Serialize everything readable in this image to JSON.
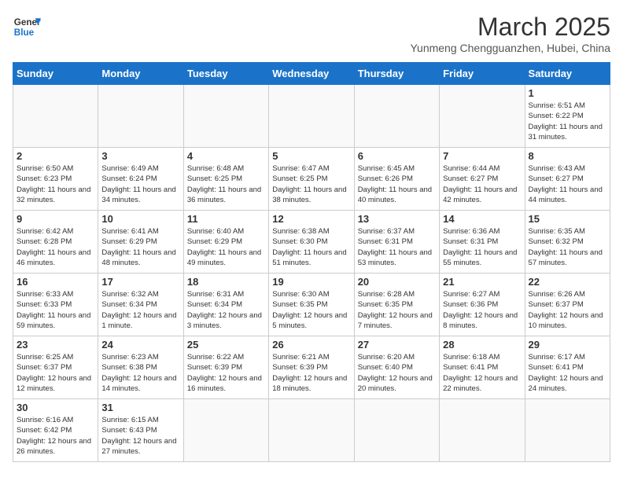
{
  "header": {
    "logo_general": "General",
    "logo_blue": "Blue",
    "title": "March 2025",
    "location": "Yunmeng Chengguanzhen, Hubei, China"
  },
  "weekdays": [
    "Sunday",
    "Monday",
    "Tuesday",
    "Wednesday",
    "Thursday",
    "Friday",
    "Saturday"
  ],
  "weeks": [
    [
      {
        "day": "",
        "info": ""
      },
      {
        "day": "",
        "info": ""
      },
      {
        "day": "",
        "info": ""
      },
      {
        "day": "",
        "info": ""
      },
      {
        "day": "",
        "info": ""
      },
      {
        "day": "",
        "info": ""
      },
      {
        "day": "1",
        "info": "Sunrise: 6:51 AM\nSunset: 6:22 PM\nDaylight: 11 hours and 31 minutes."
      }
    ],
    [
      {
        "day": "2",
        "info": "Sunrise: 6:50 AM\nSunset: 6:23 PM\nDaylight: 11 hours and 32 minutes."
      },
      {
        "day": "3",
        "info": "Sunrise: 6:49 AM\nSunset: 6:24 PM\nDaylight: 11 hours and 34 minutes."
      },
      {
        "day": "4",
        "info": "Sunrise: 6:48 AM\nSunset: 6:25 PM\nDaylight: 11 hours and 36 minutes."
      },
      {
        "day": "5",
        "info": "Sunrise: 6:47 AM\nSunset: 6:25 PM\nDaylight: 11 hours and 38 minutes."
      },
      {
        "day": "6",
        "info": "Sunrise: 6:45 AM\nSunset: 6:26 PM\nDaylight: 11 hours and 40 minutes."
      },
      {
        "day": "7",
        "info": "Sunrise: 6:44 AM\nSunset: 6:27 PM\nDaylight: 11 hours and 42 minutes."
      },
      {
        "day": "8",
        "info": "Sunrise: 6:43 AM\nSunset: 6:27 PM\nDaylight: 11 hours and 44 minutes."
      }
    ],
    [
      {
        "day": "9",
        "info": "Sunrise: 6:42 AM\nSunset: 6:28 PM\nDaylight: 11 hours and 46 minutes."
      },
      {
        "day": "10",
        "info": "Sunrise: 6:41 AM\nSunset: 6:29 PM\nDaylight: 11 hours and 48 minutes."
      },
      {
        "day": "11",
        "info": "Sunrise: 6:40 AM\nSunset: 6:29 PM\nDaylight: 11 hours and 49 minutes."
      },
      {
        "day": "12",
        "info": "Sunrise: 6:38 AM\nSunset: 6:30 PM\nDaylight: 11 hours and 51 minutes."
      },
      {
        "day": "13",
        "info": "Sunrise: 6:37 AM\nSunset: 6:31 PM\nDaylight: 11 hours and 53 minutes."
      },
      {
        "day": "14",
        "info": "Sunrise: 6:36 AM\nSunset: 6:31 PM\nDaylight: 11 hours and 55 minutes."
      },
      {
        "day": "15",
        "info": "Sunrise: 6:35 AM\nSunset: 6:32 PM\nDaylight: 11 hours and 57 minutes."
      }
    ],
    [
      {
        "day": "16",
        "info": "Sunrise: 6:33 AM\nSunset: 6:33 PM\nDaylight: 11 hours and 59 minutes."
      },
      {
        "day": "17",
        "info": "Sunrise: 6:32 AM\nSunset: 6:34 PM\nDaylight: 12 hours and 1 minute."
      },
      {
        "day": "18",
        "info": "Sunrise: 6:31 AM\nSunset: 6:34 PM\nDaylight: 12 hours and 3 minutes."
      },
      {
        "day": "19",
        "info": "Sunrise: 6:30 AM\nSunset: 6:35 PM\nDaylight: 12 hours and 5 minutes."
      },
      {
        "day": "20",
        "info": "Sunrise: 6:28 AM\nSunset: 6:35 PM\nDaylight: 12 hours and 7 minutes."
      },
      {
        "day": "21",
        "info": "Sunrise: 6:27 AM\nSunset: 6:36 PM\nDaylight: 12 hours and 8 minutes."
      },
      {
        "day": "22",
        "info": "Sunrise: 6:26 AM\nSunset: 6:37 PM\nDaylight: 12 hours and 10 minutes."
      }
    ],
    [
      {
        "day": "23",
        "info": "Sunrise: 6:25 AM\nSunset: 6:37 PM\nDaylight: 12 hours and 12 minutes."
      },
      {
        "day": "24",
        "info": "Sunrise: 6:23 AM\nSunset: 6:38 PM\nDaylight: 12 hours and 14 minutes."
      },
      {
        "day": "25",
        "info": "Sunrise: 6:22 AM\nSunset: 6:39 PM\nDaylight: 12 hours and 16 minutes."
      },
      {
        "day": "26",
        "info": "Sunrise: 6:21 AM\nSunset: 6:39 PM\nDaylight: 12 hours and 18 minutes."
      },
      {
        "day": "27",
        "info": "Sunrise: 6:20 AM\nSunset: 6:40 PM\nDaylight: 12 hours and 20 minutes."
      },
      {
        "day": "28",
        "info": "Sunrise: 6:18 AM\nSunset: 6:41 PM\nDaylight: 12 hours and 22 minutes."
      },
      {
        "day": "29",
        "info": "Sunrise: 6:17 AM\nSunset: 6:41 PM\nDaylight: 12 hours and 24 minutes."
      }
    ],
    [
      {
        "day": "30",
        "info": "Sunrise: 6:16 AM\nSunset: 6:42 PM\nDaylight: 12 hours and 26 minutes."
      },
      {
        "day": "31",
        "info": "Sunrise: 6:15 AM\nSunset: 6:43 PM\nDaylight: 12 hours and 27 minutes."
      },
      {
        "day": "",
        "info": ""
      },
      {
        "day": "",
        "info": ""
      },
      {
        "day": "",
        "info": ""
      },
      {
        "day": "",
        "info": ""
      },
      {
        "day": "",
        "info": ""
      }
    ]
  ]
}
